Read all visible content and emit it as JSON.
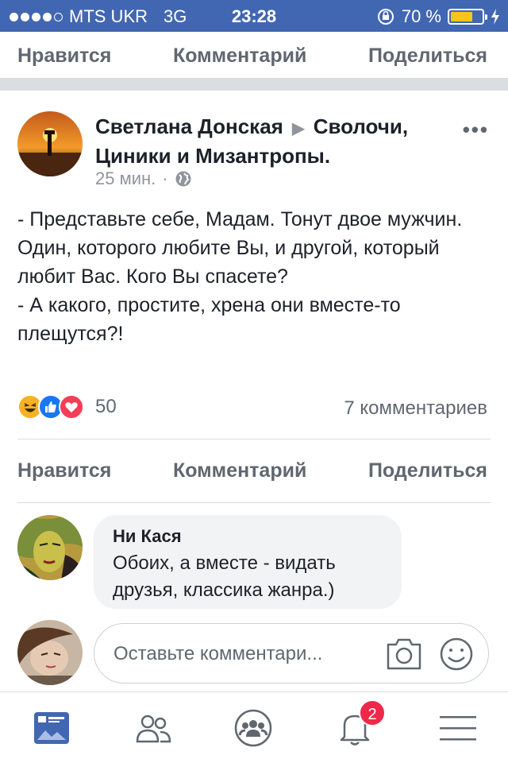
{
  "status_bar": {
    "carrier": "MTS UKR",
    "network": "3G",
    "time": "23:28",
    "battery_percent": "70 %",
    "battery_level": 0.7
  },
  "actions_top": {
    "like": "Нравится",
    "comment": "Комментарий",
    "share": "Поделиться"
  },
  "post": {
    "author": "Светлана Донская",
    "arrow": "▶",
    "group": "Сволочи, Циники и Мизантропы.",
    "time": "25 мин.",
    "separator": "·",
    "text": "- Представьте себе, Мадам. Тонут двое мужчин. Один, которого любите Вы, и другой, который любит Вас. Кого Вы спасете?\n- А какого, простите, хрена они вместе-то плещутся?!",
    "reactions_count": "50",
    "comments_count": "7 комментариев"
  },
  "actions_bottom": {
    "like": "Нравится",
    "comment": "Комментарий",
    "share": "Поделиться"
  },
  "comment": {
    "name": "Ни Кася",
    "text": "Обоих, а вместе - видать друзья, классика жанра.)"
  },
  "comment_input": {
    "placeholder": "Оставьте комментари..."
  },
  "tabbar": {
    "notifications_badge": "2",
    "accent": "#4267b2"
  },
  "colors": {
    "brand": "#4267b2",
    "like": "#1877f2",
    "love": "#f33e58",
    "haha": "#f7b125",
    "badge": "#f02849"
  }
}
